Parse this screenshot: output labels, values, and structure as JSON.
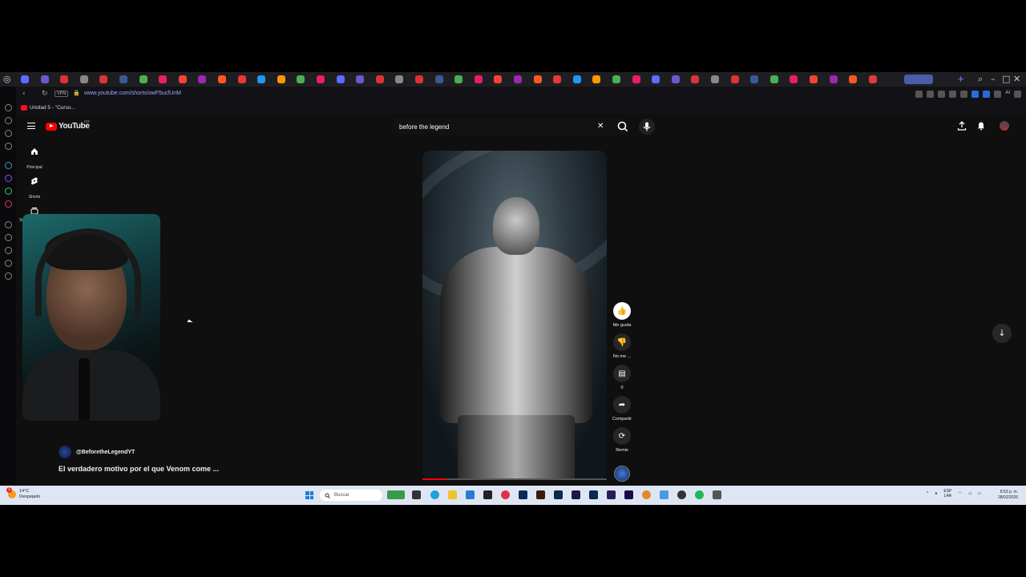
{
  "browser": {
    "url": "www.youtube.com/shorts/owF5ucfUnM",
    "vpn_label": "VPN",
    "bookmark": "Unidad 5 - \"Curso...",
    "tab_colors": [
      "#5b6cff",
      "#6a5acd",
      "#d33",
      "#888",
      "#d33",
      "#3b5998",
      "#4caf50",
      "#e91e63",
      "#f44336",
      "#9c27b0",
      "#ff5722",
      "#e53935",
      "#2196f3",
      "#ff9800",
      "#4caf50",
      "#e91e63"
    ],
    "ai_label": "AI"
  },
  "youtube": {
    "logo_text": "YouTube",
    "country_code": "CO",
    "search": {
      "query": "before the legend"
    },
    "guide": {
      "home_label": "Principal",
      "shorts_label": "Shorts",
      "subs_label": "Su"
    },
    "short": {
      "channel": "@BeforetheLegendYT",
      "title": "El verdadero motivo por el que Venom come ...",
      "progress": 0.13
    },
    "actions": {
      "like_label": "Me gusta",
      "dislike_label": "No me ...",
      "comments_count": "0",
      "share_label": "Compartir",
      "remix_label": "Remix"
    }
  },
  "taskbar": {
    "weather_temp": "14°C",
    "weather_desc": "Despejado",
    "weather_alert": "1",
    "search_placeholder": "Buscar",
    "lang_top": "ESP",
    "lang_bottom": "LAA",
    "time": "8:53 p. m.",
    "date": "28/02/2026"
  }
}
